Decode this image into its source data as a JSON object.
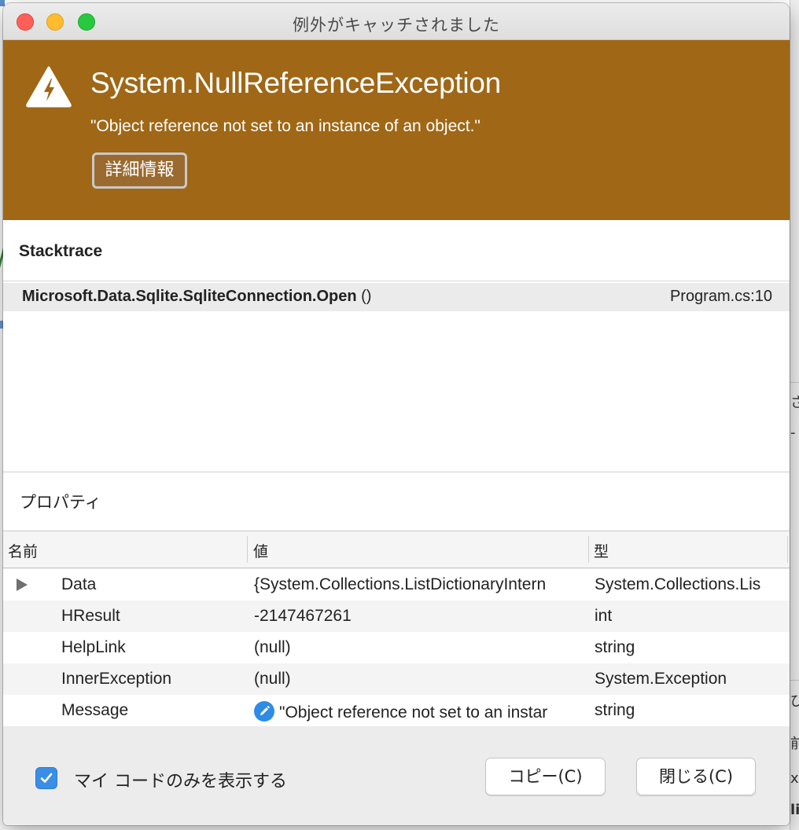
{
  "window": {
    "title": "例外がキャッチされました"
  },
  "exception": {
    "type": "System.NullReferenceException",
    "message": "\"Object reference not set to an instance of an object.\"",
    "details_button": "詳細情報",
    "icon": "warning-bolt-icon",
    "banner_color": "#9f6716"
  },
  "stacktrace": {
    "title": "Stacktrace",
    "frames": [
      {
        "method": "Microsoft.Data.Sqlite.SqliteConnection.Open",
        "args": " ()",
        "location": "Program.cs:10"
      }
    ]
  },
  "properties": {
    "title": "プロパティ",
    "columns": {
      "name": "名前",
      "value": "値",
      "type": "型"
    },
    "rows": [
      {
        "name": "Data",
        "value": "{System.Collections.ListDictionaryIntern",
        "type": "System.Collections.Lis",
        "expandable": true
      },
      {
        "name": "HResult",
        "value": "-2147467261",
        "type": "int"
      },
      {
        "name": "HelpLink",
        "value": "(null)",
        "type": "string"
      },
      {
        "name": "InnerException",
        "value": "(null)",
        "type": "System.Exception"
      },
      {
        "name": "Message",
        "value": "\"Object reference not set to an instar",
        "type": "string",
        "editable": true
      }
    ]
  },
  "footer": {
    "checkbox_label": "マイ コードのみを表示する",
    "checkbox_checked": true,
    "copy_button": "コピー(C)",
    "close_button": "閉じる(C)",
    "accent_color": "#3a8ee6"
  },
  "background": {
    "right_glyphs": [
      "さ",
      "-",
      "び",
      "前",
      "xt",
      "li"
    ]
  }
}
